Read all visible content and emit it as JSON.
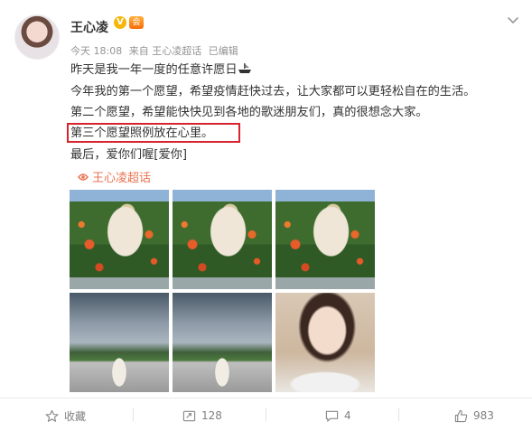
{
  "post": {
    "author": "王心凌",
    "verified_badge": "V",
    "vip_badge": "会",
    "meta": {
      "time": "今天 18:08",
      "source": "来自 王心凌超话",
      "edited": "已编辑"
    },
    "lines": [
      "昨天是我一年一度的任意许愿日",
      "今年我的第一个愿望，希望疫情赶快过去，让大家都可以更轻松自在的生活。",
      "第二个愿望，希望能快快见到各地的歌迷朋友们，真的很想念大家。",
      "第三个愿望照例放在心里。",
      "最后，爱你们喔[爱你]"
    ],
    "topic": "王心凌超话",
    "highlight_color": "#d6232d",
    "topic_color": "#eb7350",
    "photos": [
      {
        "name": "photo-1",
        "scene": "garden"
      },
      {
        "name": "photo-2",
        "scene": "garden"
      },
      {
        "name": "photo-3",
        "scene": "garden"
      },
      {
        "name": "photo-4",
        "scene": "sky"
      },
      {
        "name": "photo-5",
        "scene": "sky"
      },
      {
        "name": "photo-6",
        "scene": "cafe"
      }
    ]
  },
  "actions": {
    "favorite_label": "收藏",
    "repost_count": "128",
    "comment_count": "4",
    "like_count": "983",
    "icons": [
      "star-icon",
      "repost-icon",
      "comment-icon",
      "thumbs-up-icon"
    ]
  }
}
